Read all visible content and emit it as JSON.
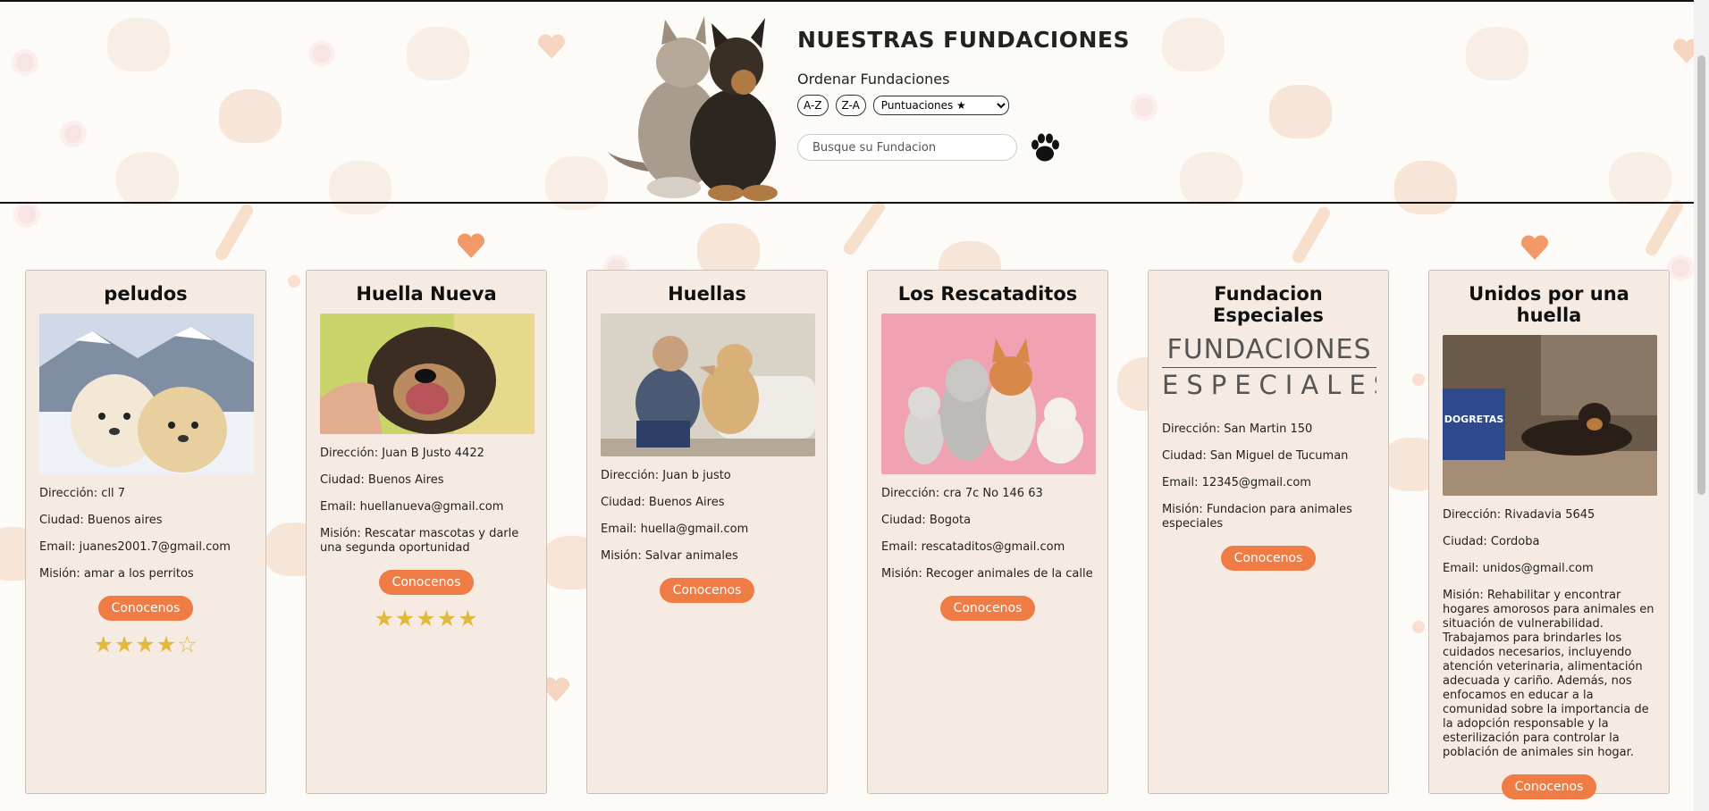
{
  "header": {
    "title": "NUESTRAS FUNDACIONES",
    "sort_label": "Ordenar Fundaciones",
    "sort_az": "A-Z",
    "sort_za": "Z-A",
    "sort_select_value": "Puntuaciones ★",
    "search_placeholder": "Busque su Fundacion"
  },
  "colors": {
    "card_bg": "#f6ebe2",
    "button": "#ef7b45",
    "star": "#e2b93b"
  },
  "cards": [
    {
      "title": "peludos",
      "address": "Dirección: cll 7",
      "city": "Ciudad: Buenos aires",
      "email": "Email: juanes2001.7@gmail.com",
      "mission": "Misión: amar a los perritos",
      "button": "Conocenos",
      "stars": "★★★★☆"
    },
    {
      "title": "Huella Nueva",
      "address": "Dirección: Juan B Justo 4422",
      "city": "Ciudad: Buenos Aires",
      "email": "Email: huellanueva@gmail.com",
      "mission": "Misión: Rescatar mascotas y darle una segunda oportunidad",
      "button": "Conocenos",
      "stars": "★★★★★"
    },
    {
      "title": "Huellas",
      "address": "Dirección: Juan b justo",
      "city": "Ciudad: Buenos Aires",
      "email": "Email: huella@gmail.com",
      "mission": "Misión: Salvar animales",
      "button": "Conocenos"
    },
    {
      "title": "Los Rescataditos",
      "address": "Dirección: cra 7c No 146 63",
      "city": "Ciudad: Bogota",
      "email": "Email: rescataditos@gmail.com",
      "mission": "Misión: Recoger animales de la calle",
      "button": "Conocenos"
    },
    {
      "title": "Fundacion Especiales",
      "logo_line1": "FUNDACIONES",
      "logo_line2": "ESPECIALES",
      "address": "Dirección: San Martin 150",
      "city": "Ciudad: San Miguel de Tucuman",
      "email": "Email: 12345@gmail.com",
      "mission": "Misión: Fundacion para animales especiales",
      "button": "Conocenos"
    },
    {
      "title": "Unidos por una huella",
      "address": "Dirección: Rivadavia 5645",
      "city": "Ciudad: Cordoba",
      "email": "Email: unidos@gmail.com",
      "mission": "Misión: Rehabilitar y encontrar hogares amorosos para animales en situación de vulnerabilidad. Trabajamos para brindarles los cuidados necesarios, incluyendo atención veterinaria, alimentación adecuada y cariño. Además, nos enfocamos en educar a la comunidad sobre la importancia de la adopción responsable y la esterilización para controlar la población de animales sin hogar.",
      "button": "Conocenos",
      "image_label": "DOGRETAS"
    }
  ]
}
